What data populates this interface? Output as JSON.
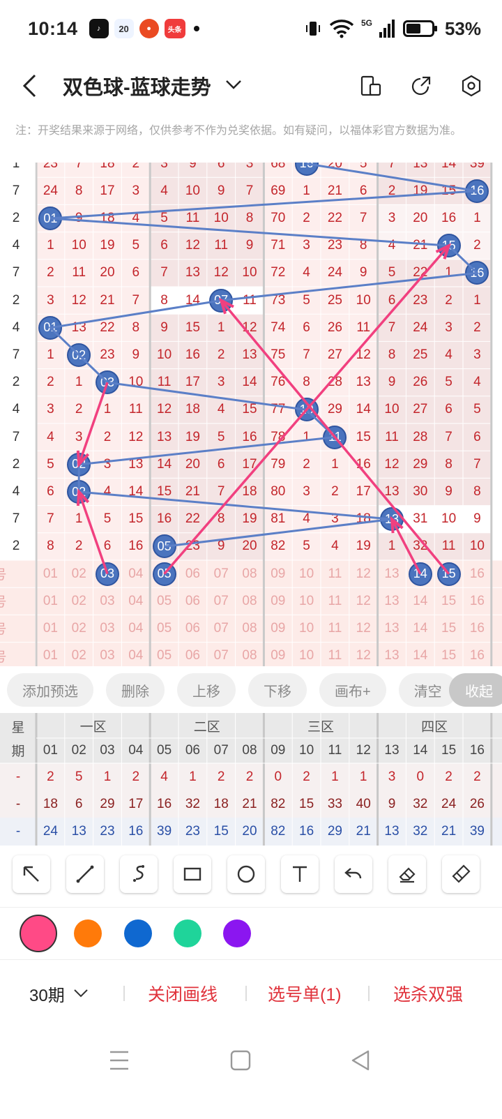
{
  "status": {
    "time": "10:14",
    "badge_20": "20",
    "toutiao": "头条",
    "battery": "53%",
    "network": "5G"
  },
  "header": {
    "title": "双色球-蓝球走势"
  },
  "notice": "注：开奖结果来源于网络，仅供参考不作为兑奖依据。如有疑问，以福体彩官方数据为准。",
  "trend": {
    "rows": [
      {
        "left": "1",
        "vals": [
          "23",
          "7",
          "18",
          "2",
          "3",
          "9",
          "6",
          "3",
          "68",
          "16",
          "20",
          "5",
          "7",
          "13",
          "14",
          "39"
        ]
      },
      {
        "left": "7",
        "vals": [
          "24",
          "8",
          "17",
          "3",
          "4",
          "10",
          "9",
          "7",
          "69",
          "1",
          "21",
          "6",
          "2",
          "19",
          "15",
          "16"
        ]
      },
      {
        "left": "2",
        "vals": [
          "01",
          "9",
          "18",
          "4",
          "5",
          "11",
          "10",
          "8",
          "70",
          "2",
          "22",
          "7",
          "3",
          "20",
          "16",
          "1"
        ]
      },
      {
        "left": "4",
        "vals": [
          "1",
          "10",
          "19",
          "5",
          "6",
          "12",
          "11",
          "9",
          "71",
          "3",
          "23",
          "8",
          "4",
          "21",
          "15",
          "2"
        ]
      },
      {
        "left": "7",
        "vals": [
          "2",
          "11",
          "20",
          "6",
          "7",
          "13",
          "12",
          "10",
          "72",
          "4",
          "24",
          "9",
          "5",
          "22",
          "1",
          "16"
        ]
      },
      {
        "left": "2",
        "vals": [
          "3",
          "12",
          "21",
          "7",
          "8",
          "14",
          "07",
          "11",
          "73",
          "5",
          "25",
          "10",
          "6",
          "23",
          "2",
          "1"
        ]
      },
      {
        "left": "4",
        "vals": [
          "01",
          "13",
          "22",
          "8",
          "9",
          "15",
          "1",
          "12",
          "74",
          "6",
          "26",
          "11",
          "7",
          "24",
          "3",
          "2"
        ]
      },
      {
        "left": "7",
        "vals": [
          "1",
          "02",
          "23",
          "9",
          "10",
          "16",
          "2",
          "13",
          "75",
          "7",
          "27",
          "12",
          "8",
          "25",
          "4",
          "3"
        ]
      },
      {
        "left": "2",
        "vals": [
          "2",
          "1",
          "03",
          "10",
          "11",
          "17",
          "3",
          "14",
          "76",
          "8",
          "28",
          "13",
          "9",
          "26",
          "5",
          "4"
        ]
      },
      {
        "left": "4",
        "vals": [
          "3",
          "2",
          "1",
          "11",
          "12",
          "18",
          "4",
          "15",
          "77",
          "10",
          "29",
          "14",
          "10",
          "27",
          "6",
          "5"
        ]
      },
      {
        "left": "7",
        "vals": [
          "4",
          "3",
          "2",
          "12",
          "13",
          "19",
          "5",
          "16",
          "78",
          "1",
          "11",
          "15",
          "11",
          "28",
          "7",
          "6"
        ]
      },
      {
        "left": "2",
        "vals": [
          "5",
          "02",
          "3",
          "13",
          "14",
          "20",
          "6",
          "17",
          "79",
          "2",
          "1",
          "16",
          "12",
          "29",
          "8",
          "7"
        ]
      },
      {
        "left": "4",
        "vals": [
          "6",
          "02",
          "4",
          "14",
          "15",
          "21",
          "7",
          "18",
          "80",
          "3",
          "2",
          "17",
          "13",
          "30",
          "9",
          "8"
        ]
      },
      {
        "left": "7",
        "vals": [
          "7",
          "1",
          "5",
          "15",
          "16",
          "22",
          "8",
          "19",
          "81",
          "4",
          "3",
          "18",
          "13",
          "31",
          "10",
          "9"
        ]
      },
      {
        "left": "2",
        "vals": [
          "8",
          "2",
          "6",
          "16",
          "05",
          "23",
          "9",
          "20",
          "82",
          "5",
          "4",
          "19",
          "1",
          "32",
          "11",
          "10"
        ]
      }
    ],
    "pick_rows_label": "号",
    "numbers": [
      "01",
      "02",
      "03",
      "04",
      "05",
      "06",
      "07",
      "08",
      "09",
      "10",
      "11",
      "12",
      "13",
      "14",
      "15",
      "16"
    ],
    "picked_first_row": [
      "03",
      "05",
      "14",
      "15"
    ]
  },
  "buttons": {
    "add": "添加预选",
    "delete": "删除",
    "up": "上移",
    "down": "下移",
    "canvas": "画布+",
    "clear": "清空",
    "collapse": "收起"
  },
  "stats": {
    "week_label_1": "星",
    "week_label_2": "期",
    "zones": [
      "一区",
      "二区",
      "三区",
      "四区"
    ],
    "numbers": [
      "01",
      "02",
      "03",
      "04",
      "05",
      "06",
      "07",
      "08",
      "09",
      "10",
      "11",
      "12",
      "13",
      "14",
      "15",
      "16"
    ],
    "row1": [
      "2",
      "5",
      "1",
      "2",
      "4",
      "1",
      "2",
      "2",
      "0",
      "2",
      "1",
      "1",
      "3",
      "0",
      "2",
      "2"
    ],
    "row2": [
      "18",
      "6",
      "29",
      "17",
      "16",
      "32",
      "18",
      "21",
      "82",
      "15",
      "33",
      "40",
      "9",
      "32",
      "24",
      "26"
    ],
    "row3": [
      "24",
      "13",
      "23",
      "16",
      "39",
      "23",
      "15",
      "20",
      "82",
      "16",
      "29",
      "21",
      "13",
      "32",
      "21",
      "39"
    ],
    "dash": "-"
  },
  "tools": [
    "arrow-tool",
    "line-tool",
    "curve-tool",
    "rect-tool",
    "circle-tool",
    "text-tool",
    "undo-tool",
    "eraser-tool",
    "clear-tool"
  ],
  "colors": [
    "#ff4a86",
    "#ff7a0a",
    "#0f68d0",
    "#1fd49a",
    "#8b16f0"
  ],
  "bottom": {
    "period": "30期",
    "close_draw": "关闭画线",
    "pick_list": "选号单(1)",
    "kill_double": "选杀双强"
  }
}
